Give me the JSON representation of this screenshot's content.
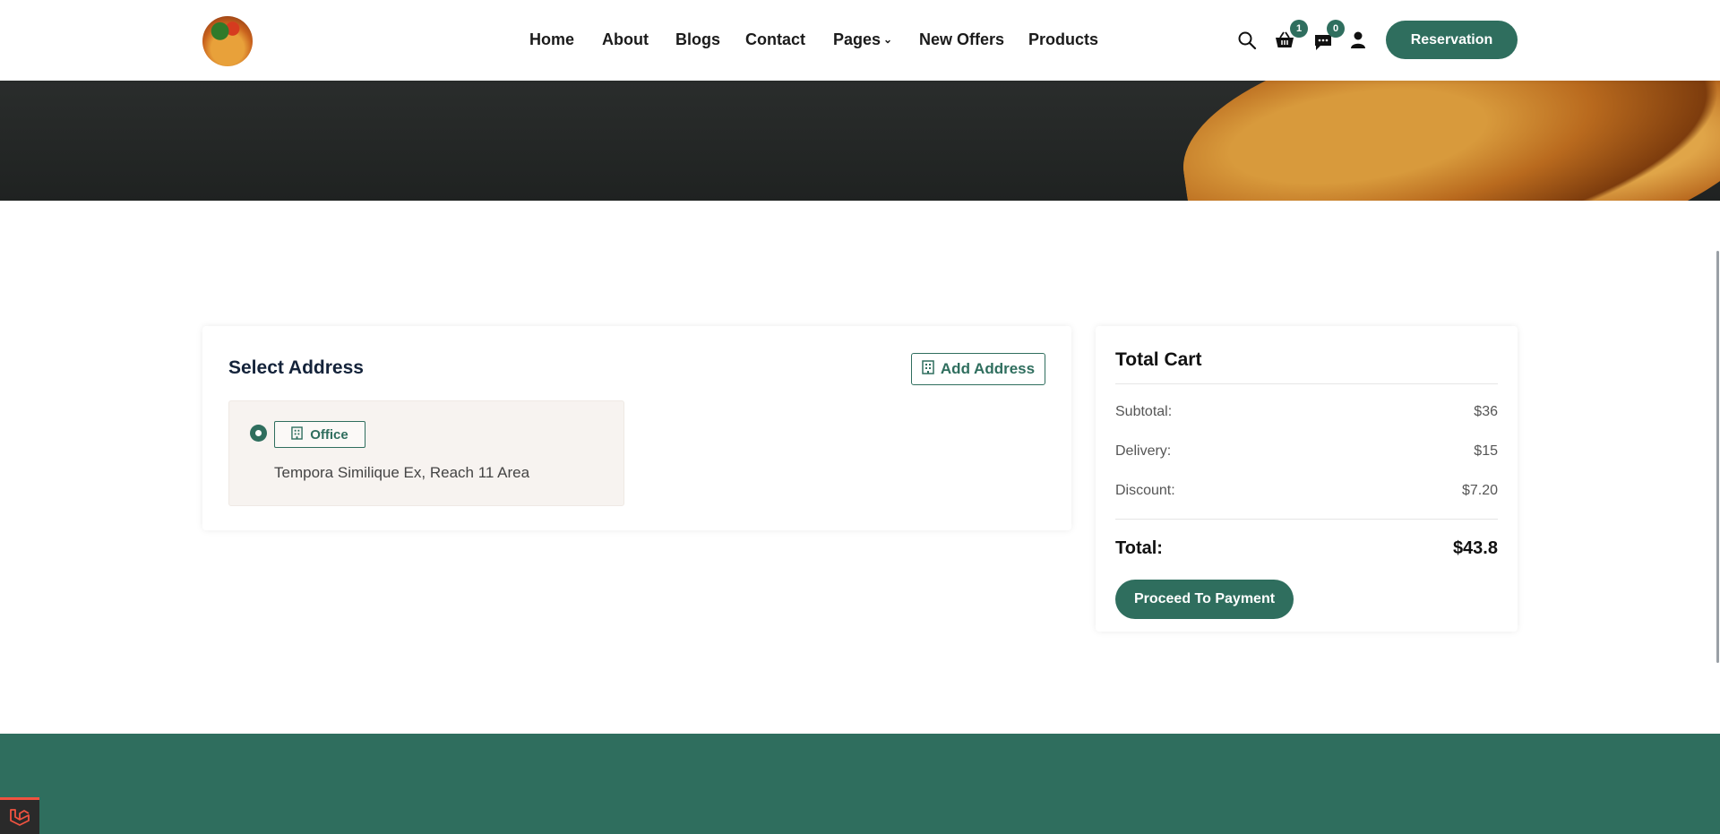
{
  "header": {
    "logo_name": "restaurant-logo",
    "nav": [
      {
        "label": "Home"
      },
      {
        "label": "About"
      },
      {
        "label": "Blogs"
      },
      {
        "label": "Contact"
      },
      {
        "label": "Pages",
        "has_dropdown": true
      },
      {
        "label": "New Offers"
      },
      {
        "label": "Products"
      }
    ],
    "cart_count": "1",
    "chat_count": "0",
    "reservation_label": "Reservation"
  },
  "address_section": {
    "title": "Select Address",
    "add_button_label": "Add Address",
    "addresses": [
      {
        "type_label": "Office",
        "text": "Tempora Similique Ex, Reach 11 Area",
        "selected": true
      }
    ]
  },
  "cart": {
    "title": "Total Cart",
    "rows": [
      {
        "label": "Subtotal:",
        "value": "$36"
      },
      {
        "label": "Delivery:",
        "value": "$15"
      },
      {
        "label": "Discount:",
        "value": "$7.20"
      }
    ],
    "total_label": "Total:",
    "total_value": "$43.8",
    "pay_button_label": "Proceed To Payment"
  },
  "colors": {
    "brand": "#2f6e5e",
    "heading": "#14233a",
    "address_bg": "#f7f3f0"
  }
}
